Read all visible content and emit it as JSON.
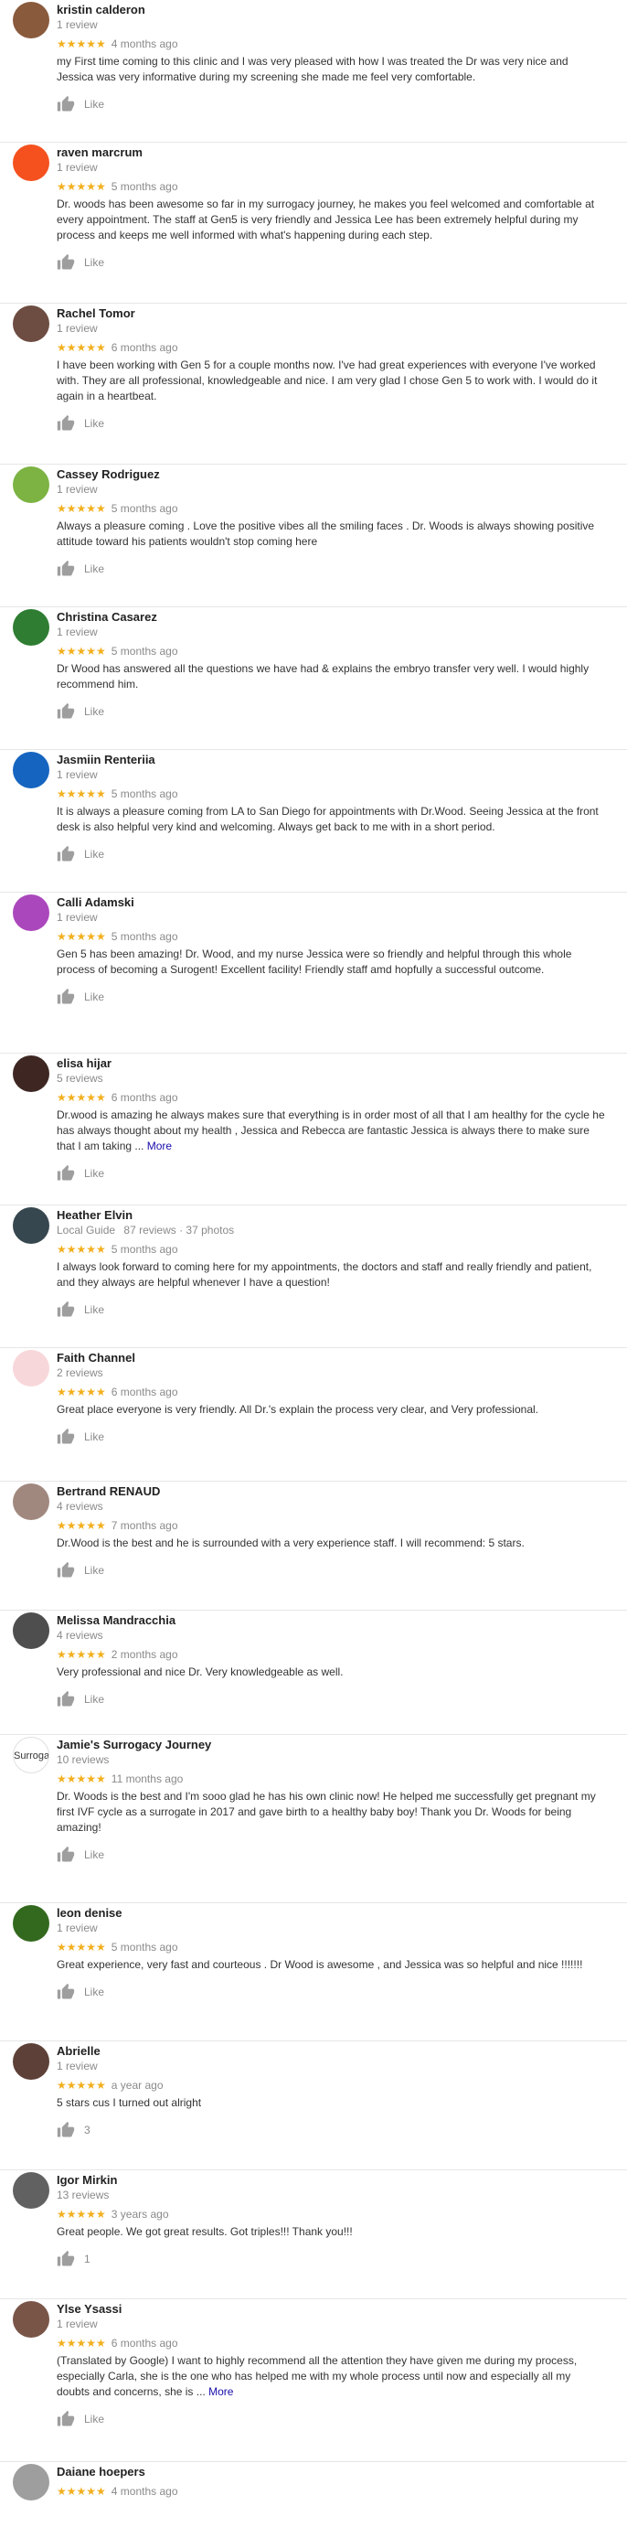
{
  "like_label": "Like",
  "more_label": "More",
  "colors": {
    "star": "#f2b01e",
    "link": "#1a0dab"
  },
  "reviews": [
    {
      "name": "kristin calderon",
      "meta": "1 review",
      "local_guide": "",
      "stars": "★★★★★",
      "date": "4 months ago",
      "text": "my First time coming to this clinic and I was very pleased with how I was treated the Dr was very nice and Jessica was very informative during my screening she made me feel very comfortable.",
      "more": false,
      "like_count": "",
      "avatar_color": "#8a5a3c",
      "avatar_initial": ""
    },
    {
      "name": "raven marcrum",
      "meta": "1 review",
      "local_guide": "",
      "stars": "★★★★★",
      "date": "5 months ago",
      "text": "Dr. woods has been awesome so far in my surrogacy journey, he makes you feel welcomed and comfortable at every appointment. The staff at Gen5 is very friendly and Jessica Lee has been extremely helpful during my process and keeps me well informed with what's happening during each step.",
      "more": false,
      "like_count": "",
      "avatar_color": "#f4511e",
      "avatar_initial": ""
    },
    {
      "name": "Rachel Tomor",
      "meta": "1 review",
      "local_guide": "",
      "stars": "★★★★★",
      "date": "6 months ago",
      "text": "I have been working with Gen 5 for a couple months now.  I've had great experiences with everyone I've worked with.  They are all professional,  knowledgeable and nice.  I am very glad I chose Gen 5 to work with.  I would do it again in a heartbeat.",
      "more": false,
      "like_count": "",
      "avatar_color": "#6d4c41",
      "avatar_initial": ""
    },
    {
      "name": "Cassey Rodriguez",
      "meta": "1 review",
      "local_guide": "",
      "stars": "★★★★★",
      "date": "5 months ago",
      "text": "Always a pleasure coming . Love the positive vibes all the smiling faces  . Dr. Woods is always showing positive attitude toward his patients wouldn't stop coming here",
      "more": false,
      "like_count": "",
      "avatar_color": "#7cb342",
      "avatar_initial": ""
    },
    {
      "name": "Christina Casarez",
      "meta": "1 review",
      "local_guide": "",
      "stars": "★★★★★",
      "date": "5 months ago",
      "text": "Dr Wood has answered all the questions we have had & explains the embryo transfer very well. I would highly recommend him.",
      "more": false,
      "like_count": "",
      "avatar_color": "#2e7d32",
      "avatar_initial": ""
    },
    {
      "name": "Jasmiin Renteriia",
      "meta": "1 review",
      "local_guide": "",
      "stars": "★★★★★",
      "date": "5 months ago",
      "text": "It is always a pleasure coming from LA to San Diego for appointments with Dr.Wood. Seeing Jessica at the front desk is also helpful very kind and welcoming. Always get back to me with in a short period.",
      "more": false,
      "like_count": "",
      "avatar_color": "#1565c0",
      "avatar_initial": ""
    },
    {
      "name": "Calli Adamski",
      "meta": "1 review",
      "local_guide": "",
      "stars": "★★★★★",
      "date": "5 months ago",
      "text": "Gen 5 has been amazing! Dr. Wood, and my nurse Jessica were so friendly and helpful through this whole process of becoming a Surogent! Excellent facility! Friendly staff amd hopfully a successful outcome.",
      "more": false,
      "like_count": "",
      "avatar_color": "#ab47bc",
      "avatar_initial": ""
    },
    {
      "name": "elisa hijar",
      "meta": "5 reviews",
      "local_guide": "",
      "stars": "★★★★★",
      "date": "6 months ago",
      "text": "Dr.wood is amazing he always makes sure that everything is in order most of all that I am healthy for the cycle he has always thought about my health , Jessica and Rebecca are fantastic Jessica is always there to make sure that I am taking ...",
      "more": true,
      "like_count": "",
      "avatar_color": "#3e2723",
      "avatar_initial": ""
    },
    {
      "name": "Heather Elvin",
      "meta": "87 reviews · 37 photos",
      "local_guide": "Local Guide",
      "stars": "★★★★★",
      "date": "5 months ago",
      "text": "I always look forward to coming here for my appointments, the doctors and staff and really friendly and patient, and they always are helpful whenever I have a question!",
      "more": false,
      "like_count": "",
      "avatar_color": "#37474f",
      "avatar_initial": ""
    },
    {
      "name": "Faith Channel",
      "meta": "2 reviews",
      "local_guide": "",
      "stars": "★★★★★",
      "date": "6 months ago",
      "text": "Great place everyone is very friendly. All Dr.'s explain the process very clear, and Very professional.",
      "more": false,
      "like_count": "",
      "avatar_color": "#f8d7da",
      "avatar_initial": ""
    },
    {
      "name": "Bertrand RENAUD",
      "meta": "4 reviews",
      "local_guide": "",
      "stars": "★★★★★",
      "date": "7 months ago",
      "text": "Dr.Wood is the best and he is surrounded with a very experience staff. I will recommend: 5 stars.",
      "more": false,
      "like_count": "",
      "avatar_color": "#a1887f",
      "avatar_initial": ""
    },
    {
      "name": "Melissa Mandracchia",
      "meta": "4 reviews",
      "local_guide": "",
      "stars": "★★★★★",
      "date": "2 months ago",
      "text": "Very professional and nice Dr.  Very knowledgeable as well.",
      "more": false,
      "like_count": "",
      "avatar_color": "#4e4e4e",
      "avatar_initial": ""
    },
    {
      "name": "Jamie's Surrogacy Journey",
      "meta": "10 reviews",
      "local_guide": "",
      "stars": "★★★★★",
      "date": "11 months ago",
      "text": "Dr. Woods is the best and I'm sooo glad he has his own clinic now! He helped me successfully get pregnant my first IVF cycle as a surrogate in 2017 and gave birth to a healthy baby boy! Thank you Dr. Woods for being amazing!",
      "more": false,
      "like_count": "",
      "avatar_color": "#ffffff",
      "avatar_initial": "Surroga"
    },
    {
      "name": "leon denise",
      "meta": "1 review",
      "local_guide": "",
      "stars": "★★★★★",
      "date": "5 months ago",
      "text": "Great experience, very fast and courteous . Dr Wood is awesome , and Jessica was so helpful and nice !!!!!!!",
      "more": false,
      "like_count": "",
      "avatar_color": "#33691e",
      "avatar_initial": ""
    },
    {
      "name": "Abrielle",
      "meta": "1 review",
      "local_guide": "",
      "stars": "★★★★★",
      "date": "a year ago",
      "text": "5 stars cus I turned out alright",
      "more": false,
      "like_count": "3",
      "avatar_color": "#5d4037",
      "avatar_initial": ""
    },
    {
      "name": "Igor Mirkin",
      "meta": "13 reviews",
      "local_guide": "",
      "stars": "★★★★★",
      "date": "3 years ago",
      "text": "Great people. We got great results. Got triples!!! Thank you!!!",
      "more": false,
      "like_count": "1",
      "avatar_color": "#616161",
      "avatar_initial": ""
    },
    {
      "name": "Ylse Ysassi",
      "meta": "1 review",
      "local_guide": "",
      "stars": "★★★★★",
      "date": "6 months ago",
      "text": "(Translated by Google) I want to highly recommend all the attention they have given me during my process, especially Carla, she is the one who has helped me with my whole process until now and especially all my doubts and concerns, she is ...",
      "more": true,
      "like_count": "",
      "avatar_color": "#795548",
      "avatar_initial": ""
    },
    {
      "name": "Daiane hoepers",
      "meta": "",
      "local_guide": "",
      "stars": "★★★★★",
      "date": "4 months ago",
      "text": "",
      "more": false,
      "like_count": "",
      "avatar_color": "#9e9e9e",
      "avatar_initial": ""
    }
  ]
}
